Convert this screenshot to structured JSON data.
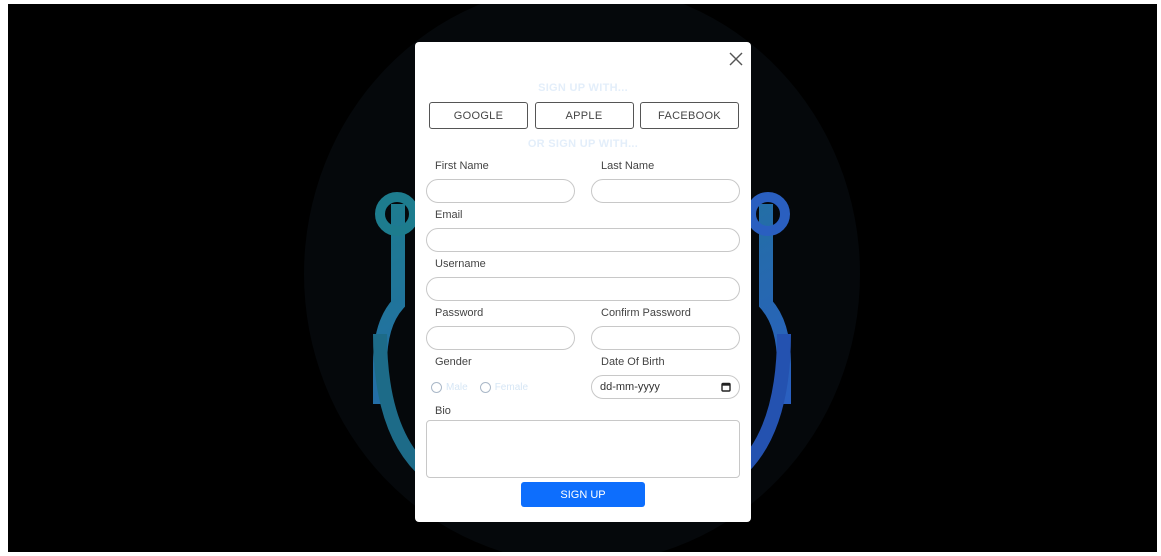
{
  "colors": {
    "backdrop": "#000000",
    "modal": "#ffffff",
    "accent": "#0d6efd",
    "heading_text": "#e3eefa",
    "art_teal": "#1d7c8e",
    "art_blue": "#2a5fc0"
  },
  "modal": {
    "close_icon": "close-icon",
    "heading_primary": "SIGN UP WITH...",
    "heading_secondary": "OR SIGN UP WITH...",
    "social": {
      "google": "GOOGLE",
      "apple": "APPLE",
      "facebook": "FACEBOOK"
    },
    "labels": {
      "first_name": "First Name",
      "last_name": "Last Name",
      "email": "Email",
      "username": "Username",
      "password": "Password",
      "confirm_password": "Confirm Password",
      "gender": "Gender",
      "dob": "Date Of Birth",
      "bio": "Bio"
    },
    "values": {
      "first_name": "",
      "last_name": "",
      "email": "",
      "username": "",
      "password": "",
      "confirm_password": "",
      "bio": ""
    },
    "gender_options": {
      "male": "Male",
      "female": "Female"
    },
    "dob_placeholder": "dd-mm-yyyy",
    "dob_icon": "calendar-icon",
    "submit": "SIGN UP"
  }
}
